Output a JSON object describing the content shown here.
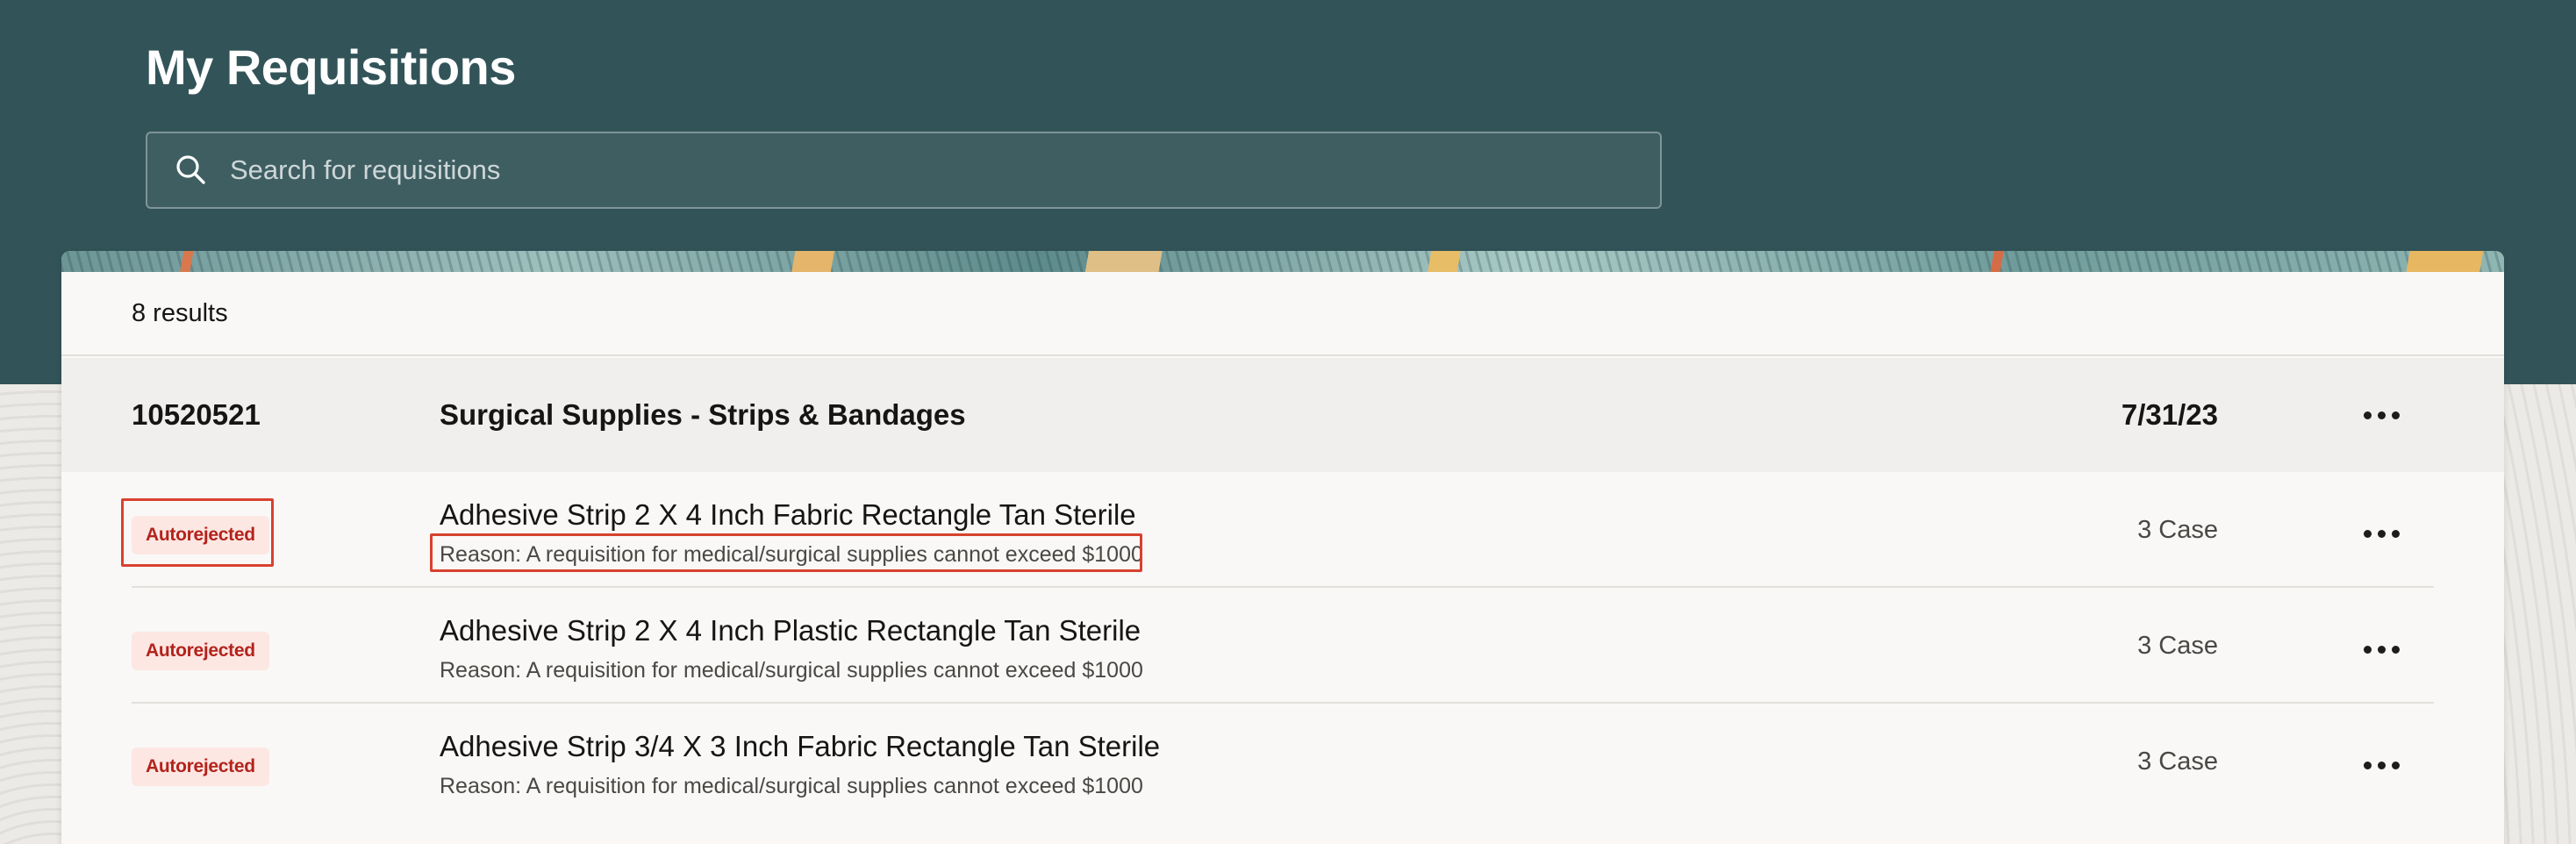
{
  "page": {
    "title": "My Requisitions"
  },
  "search": {
    "placeholder": "Search for requisitions"
  },
  "results": {
    "count_label": "8 results"
  },
  "requisition": {
    "number": "10520521",
    "title": "Surgical Supplies - Strips & Bandages",
    "date": "7/31/23"
  },
  "line_items": [
    {
      "status": "Autorejected",
      "name": "Adhesive Strip 2 X 4 Inch Fabric Rectangle Tan Sterile",
      "reason": "Reason: A requisition for medical/surgical supplies cannot exceed $1000",
      "quantity": "3 Case"
    },
    {
      "status": "Autorejected",
      "name": "Adhesive Strip 2 X 4 Inch Plastic Rectangle Tan Sterile",
      "reason": "Reason: A requisition for medical/surgical supplies cannot exceed $1000",
      "quantity": "3 Case"
    },
    {
      "status": "Autorejected",
      "name": "Adhesive Strip 3/4 X 3 Inch Fabric Rectangle Tan Sterile",
      "reason": "Reason: A requisition for medical/surgical supplies cannot exceed $1000",
      "quantity": "3 Case"
    }
  ],
  "colors": {
    "header_bg": "#325459",
    "status_text": "#b3231c",
    "status_bg": "#fde7e3",
    "highlight": "#d8412f"
  },
  "icons": {
    "search": "search-icon",
    "more": "more-actions-icon"
  }
}
